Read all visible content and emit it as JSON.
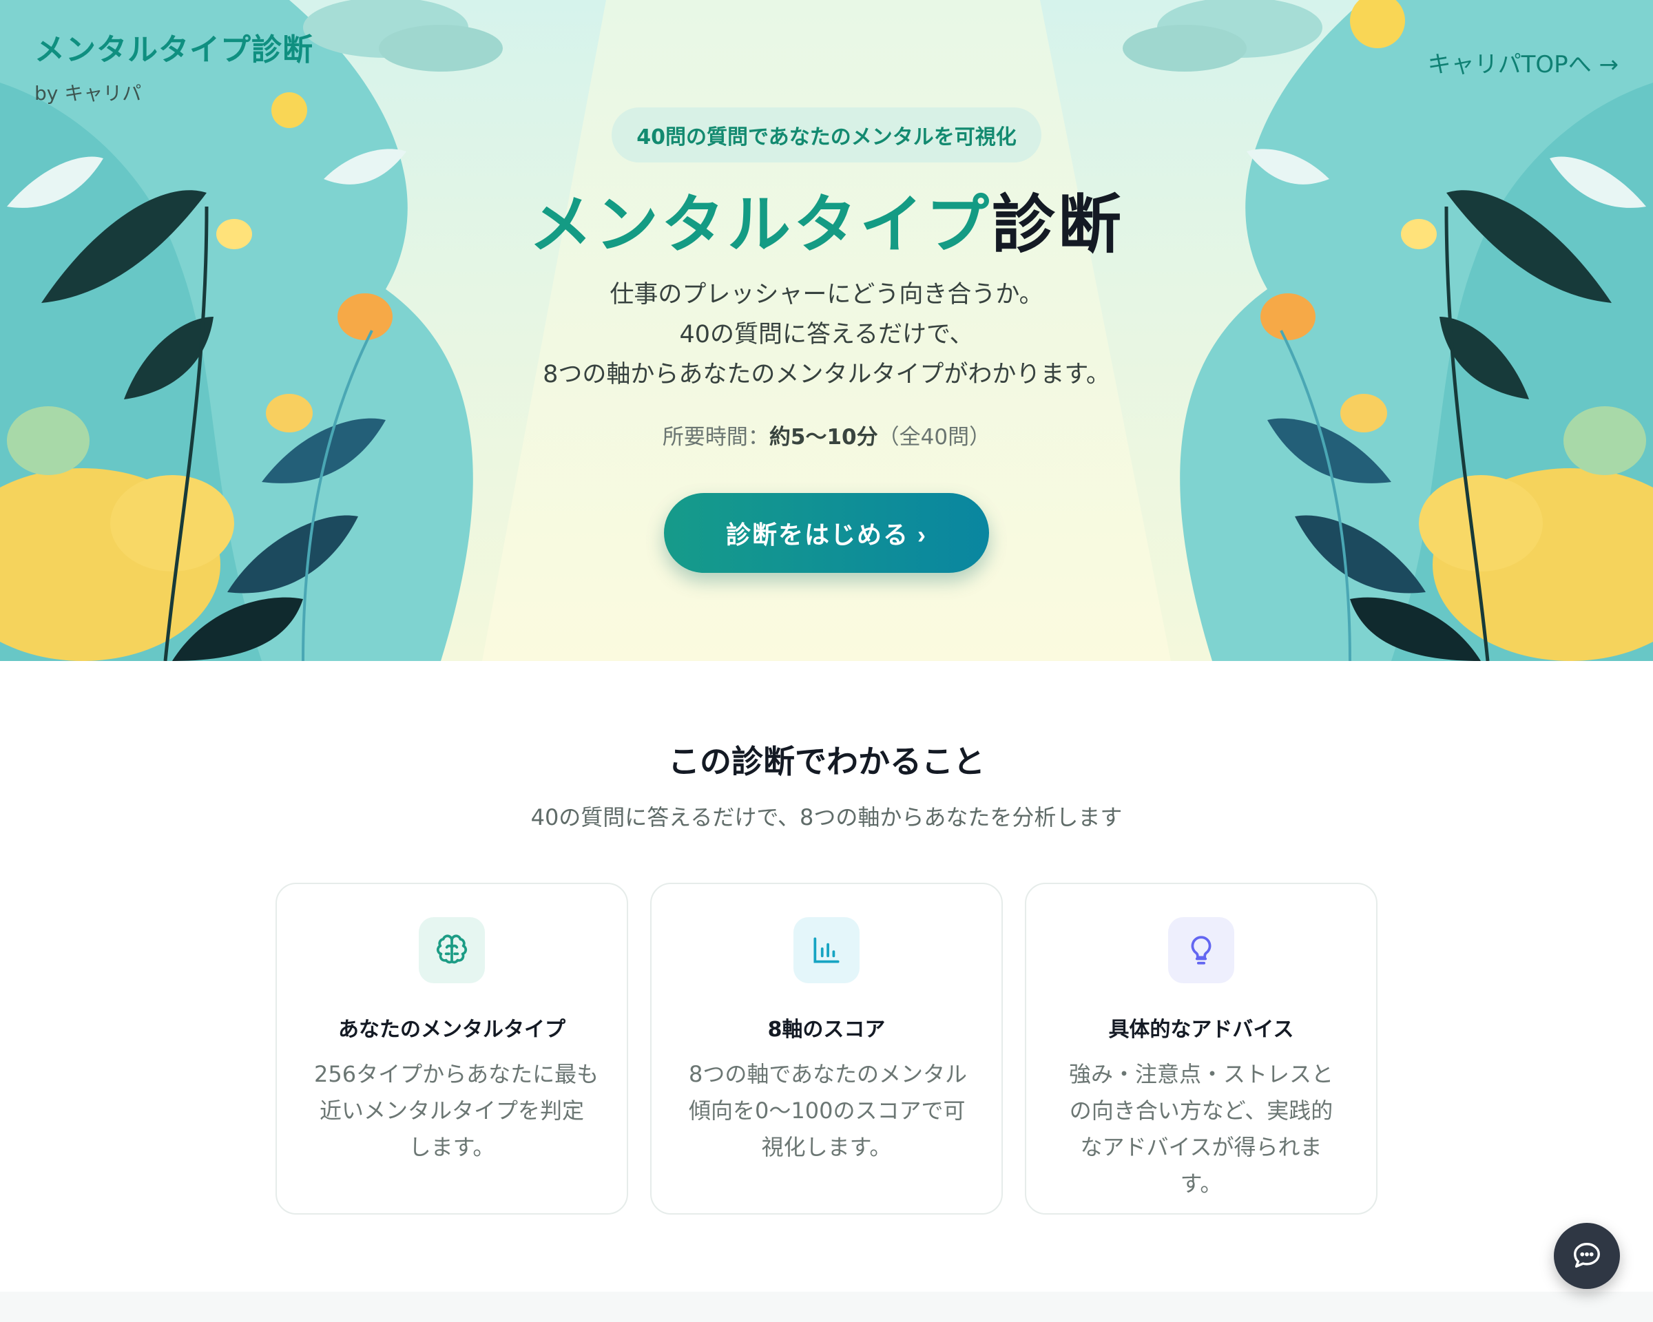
{
  "brand": {
    "title": "メンタルタイプ診断",
    "byline": "by キャリパ"
  },
  "nav": {
    "top_link": "キャリパTOPへ →"
  },
  "hero": {
    "badge": "40問の質問であなたのメンタルを可視化",
    "title_part1": "メンタルタイプ",
    "title_part2": "診断",
    "description": [
      "仕事のプレッシャーにどう向き合うか。",
      "40の質問に答えるだけで、",
      "8つの軸からあなたのメンタルタイプがわかります。"
    ],
    "time_label": "所要時間：",
    "time_value": "約5〜10分",
    "time_note": "（全40問）",
    "cta_label": "診断をはじめる ›"
  },
  "features": {
    "title": "この診断でわかること",
    "subtitle": "40の質問に答えるだけで、8つの軸からあなたを分析します",
    "cards": [
      {
        "icon": "brain-icon",
        "accent": "#1c9c85",
        "icon_bg": "#e6f6f1",
        "title": "あなたのメンタルタイプ",
        "lines": [
          "256タイプからあなたに最も",
          "近いメンタルタイプを判定",
          "します。"
        ]
      },
      {
        "icon": "bar-chart-icon",
        "accent": "#16a4c2",
        "icon_bg": "#e4f6fa",
        "title": "8軸のスコア",
        "lines": [
          "8つの軸であなたのメンタル",
          "傾向を0〜100のスコアで可",
          "視化します。"
        ]
      },
      {
        "icon": "lightbulb-icon",
        "accent": "#6366f1",
        "icon_bg": "#eeeffd",
        "title": "具体的なアドバイス",
        "lines": [
          "強み・注意点・ストレスと",
          "の向き合い方など、実践的",
          "なアドバイスが得られま",
          "す。"
        ]
      }
    ]
  },
  "chat": {
    "icon": "chat-bubble-icon"
  }
}
